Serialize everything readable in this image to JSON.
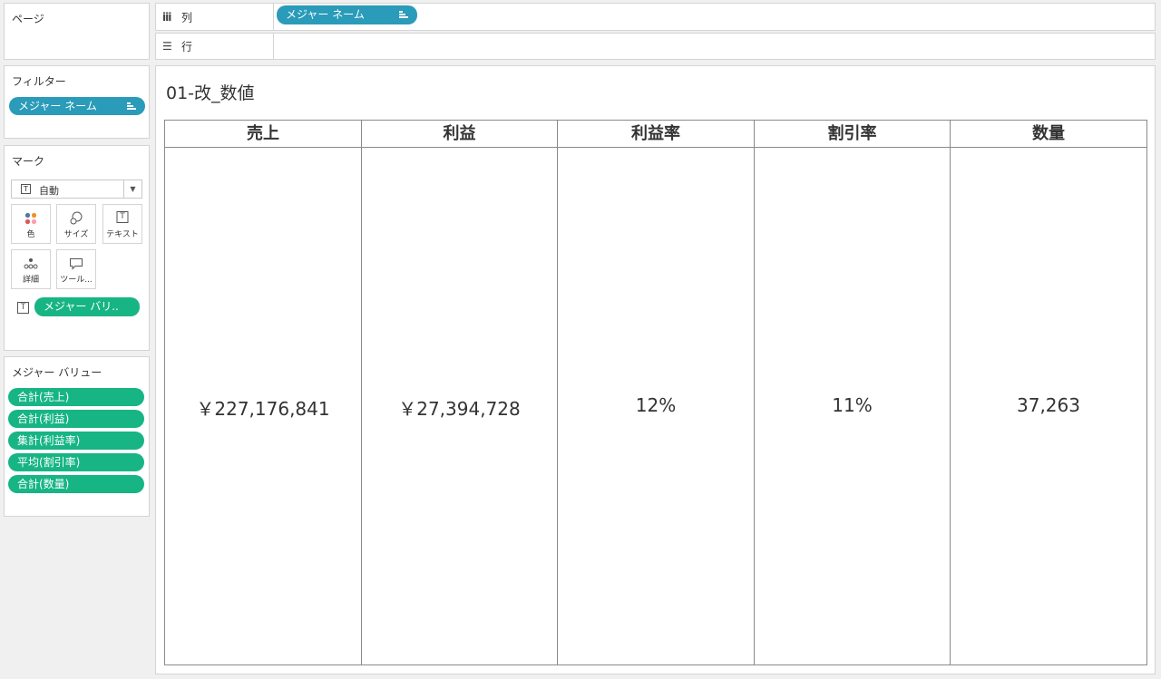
{
  "pages": {
    "title": "ページ"
  },
  "columns_shelf": {
    "label": "列",
    "pill": "メジャー ネーム"
  },
  "rows_shelf": {
    "label": "行"
  },
  "filters": {
    "title": "フィルター",
    "pill": "メジャー ネーム"
  },
  "marks": {
    "title": "マーク",
    "type_value": "自動",
    "buttons": [
      {
        "label": "色"
      },
      {
        "label": "サイズ"
      },
      {
        "label": "テキスト"
      },
      {
        "label": "詳細"
      },
      {
        "label": "ツール..."
      }
    ],
    "text_pill": "メジャー バリ.."
  },
  "measure_values": {
    "title": "メジャー バリュー",
    "pills": [
      "合計(売上)",
      "合計(利益)",
      "集計(利益率)",
      "平均(割引率)",
      "合計(数量)"
    ]
  },
  "view": {
    "title": "01-改_数値",
    "columns": [
      {
        "header": "売上",
        "value": "￥227,176,841"
      },
      {
        "header": "利益",
        "value": "￥27,394,728"
      },
      {
        "header": "利益率",
        "value": "12%"
      },
      {
        "header": "割引率",
        "value": "11%"
      },
      {
        "header": "数量",
        "value": "37,263"
      }
    ]
  },
  "colors": {
    "dimension_pill": "#2a9bb9",
    "measure_pill": "#17b583"
  }
}
